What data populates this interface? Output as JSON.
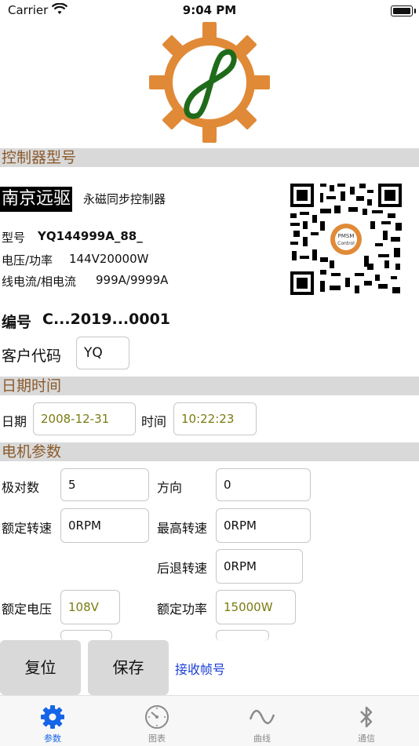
{
  "status_bar": {
    "carrier": "Carrier",
    "time": "9:04 PM"
  },
  "sections": {
    "controller_model": "控制器型号",
    "datetime": "日期时间",
    "motor_params": "电机参数"
  },
  "controller": {
    "brand": "南京远驱",
    "subtitle": "永磁同步控制器",
    "model_label": "型号",
    "model_value": "YQ144999A_88_",
    "voltage_label": "电压/功率",
    "voltage_value": "144V20000W",
    "current_label": "线电流/相电流",
    "current_value": "999A/9999A",
    "serial_label": "编号",
    "serial_value": "C...2019...0001",
    "customer_label": "客户代码",
    "customer_value": "YQ",
    "qr_badge_line1": "PMSM",
    "qr_badge_line2": "Control"
  },
  "datetime": {
    "date_label": "日期",
    "date_value": "2008-12-31",
    "time_label": "时间",
    "time_value": "10:22:23"
  },
  "motor": {
    "pole_pairs_label": "极对数",
    "pole_pairs_value": "5",
    "direction_label": "方向",
    "direction_value": "0",
    "rated_speed_label": "额定转速",
    "rated_speed_value": "0RPM",
    "max_speed_label": "最高转速",
    "max_speed_value": "0RPM",
    "reverse_speed_label": "后退转速",
    "reverse_speed_value": "0RPM",
    "rated_voltage_label": "额定电压",
    "rated_voltage_value": "108V",
    "rated_power_label": "额定功率",
    "rated_power_value": "15000W"
  },
  "actions": {
    "reset": "复位",
    "save": "保存",
    "receive_frame": "接收帧号"
  },
  "tabs": [
    {
      "label": "参数",
      "icon": "gear-icon",
      "active": true
    },
    {
      "label": "图表",
      "icon": "gauge-icon",
      "active": false
    },
    {
      "label": "曲线",
      "icon": "wave-icon",
      "active": false
    },
    {
      "label": "通信",
      "icon": "bluetooth-icon",
      "active": false
    }
  ],
  "colors": {
    "accent": "#1565e8",
    "section_text": "#8a5a2b",
    "logo_gear": "#e08a38",
    "logo_infinity": "#1f6b1a",
    "field_value": "#7b7b12"
  }
}
